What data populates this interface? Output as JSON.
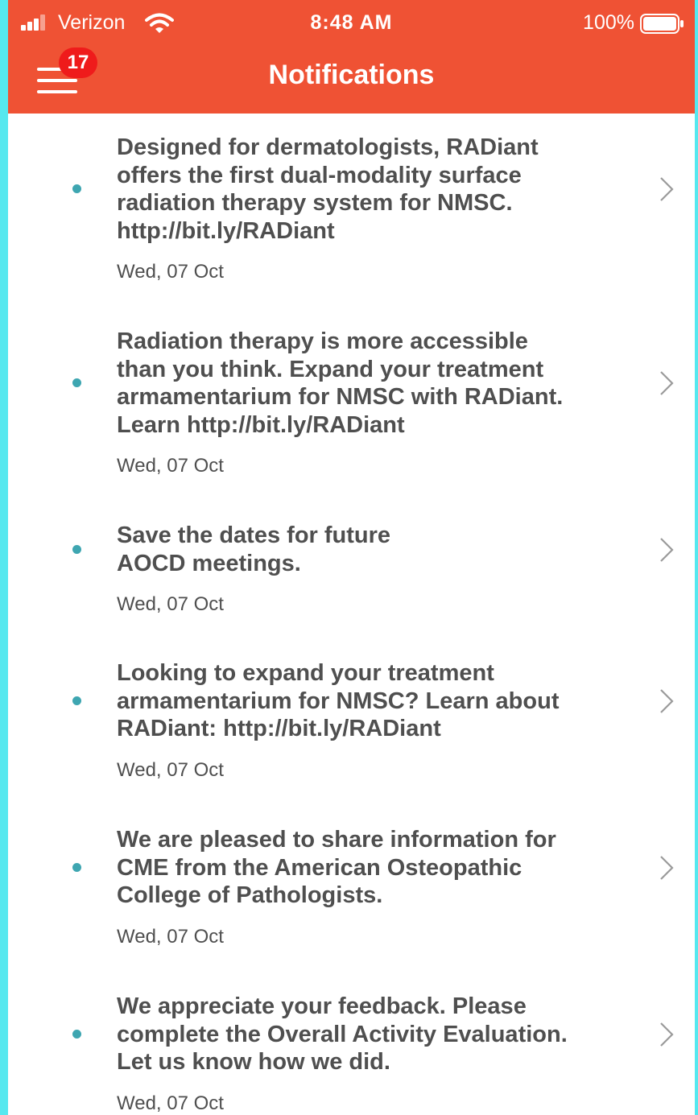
{
  "status_bar": {
    "carrier": "Verizon",
    "time": "8:48 AM",
    "battery": "100%"
  },
  "header": {
    "title": "Notifications",
    "badge_count": "17",
    "menu_icon": "hamburger-menu-icon"
  },
  "colors": {
    "header_bg": "#ef5234",
    "badge_bg": "#ef1b1b",
    "unread_dot": "#3ea6b1",
    "text": "#4f4f4f",
    "frame": "#56e8ef"
  },
  "notifications": [
    {
      "lines": [
        "Designed for dermatologists, RADiant",
        "offers the first dual-modality surface",
        "radiation therapy system for NMSC.",
        "http://bit.ly/RADiant"
      ],
      "date": "Wed, 07 Oct"
    },
    {
      "lines": [
        "Radiation therapy is more accessible",
        "than you think. Expand your treatment",
        "armamentarium for NMSC with RADiant.",
        "Learn http://bit.ly/RADiant"
      ],
      "date": "Wed, 07 Oct"
    },
    {
      "lines": [
        "Save the dates for future",
        "AOCD meetings."
      ],
      "date": "Wed, 07 Oct"
    },
    {
      "lines": [
        "Looking to expand your treatment",
        "armamentarium for NMSC? Learn about",
        "RADiant: http://bit.ly/RADiant"
      ],
      "date": "Wed, 07 Oct"
    },
    {
      "lines": [
        "We are pleased to share information for",
        "CME from the American Osteopathic",
        "College of Pathologists."
      ],
      "date": "Wed, 07 Oct"
    },
    {
      "lines": [
        "We appreciate your feedback.  Please",
        "complete the Overall Activity Evaluation.",
        "Let us know how we did."
      ],
      "date": "Wed, 07 Oct"
    }
  ]
}
